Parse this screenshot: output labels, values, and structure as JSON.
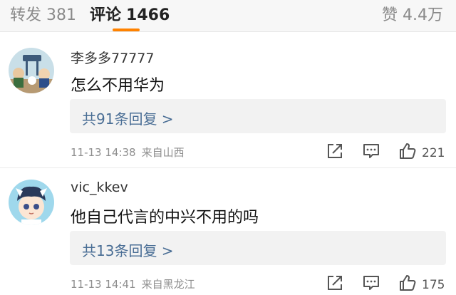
{
  "tabs": {
    "repost_label": "转发",
    "repost_count": "381",
    "comments_label": "评论",
    "comments_count": "1466",
    "like_label": "赞",
    "like_count": "4.4万"
  },
  "colors": {
    "accent": "#ff8200",
    "link": "#4a6e95",
    "meta": "#8f8f8f"
  },
  "comments": [
    {
      "username": "李多多77777",
      "text": "怎么不用华为",
      "replies_link": "共91条回复 >",
      "time": "11-13 14:38",
      "location": "来自山西",
      "likes": "221",
      "icons": [
        "share-icon",
        "reply-icon",
        "like-icon"
      ]
    },
    {
      "username": "vic_kkev",
      "text": "他自己代言的中兴不用的吗",
      "replies_link": "共13条回复 >",
      "time": "11-13 14:41",
      "location": "来自黑龙江",
      "likes": "175",
      "icons": [
        "share-icon",
        "reply-icon",
        "like-icon"
      ]
    }
  ]
}
